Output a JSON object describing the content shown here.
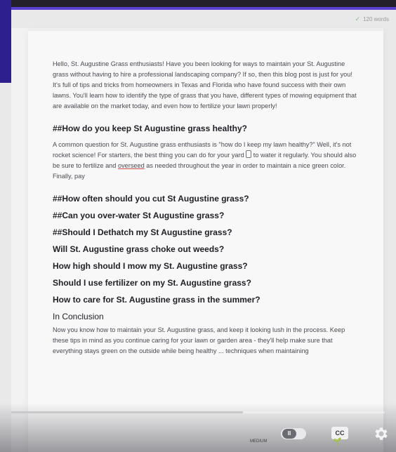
{
  "status": {
    "saved_text": "120 words"
  },
  "article": {
    "intro": "Hello, St. Augustine Grass enthusiasts! Have you been looking for ways to maintain your St. Augustine grass without having to hire a professional landscaping company? If so, then this blog post is just for you! It's full of tips and tricks from homeowners in Texas and Florida who have found success with their own lawns. You'll learn how to identify the type of grass that you have, different types of mowing equipment that are available on the market today, and even how to fertilize your lawn properly!",
    "h1": "##How do you keep St Augustine grass healthy?",
    "p1_a": "A common question for St. Augustine grass enthusiasts is \"how do I keep my lawn healthy?\" Well, it's not rocket science! For starters, the best thing you can do for your yard ",
    "p1_b": " to water it regularly. You should also be sure to fertilize and ",
    "p1_overseed": "overseed",
    "p1_c": " as needed throughout the year in order to maintain a nice green color. Finally, pay",
    "h2": "##How often should you cut St Augustine grass?",
    "h3": "##Can you over-water St Augustine grass?",
    "h4": "##Should I Dethatch my St Augustine grass?",
    "h5": "Will St. Augustine grass choke out weeds?",
    "h6": "How high should I mow my St. Augustine grass?",
    "h7": "Should I use fertilizer on my St. Augustine grass?",
    "h8": "How to care for St. Augustine grass in the summer?",
    "h9": "In Conclusion",
    "conclusion": "Now you know how to maintain your St. Augustine grass, and keep it looking lush in the process. Keep these tips in mind as you continue caring for your lawn or garden area - they'll help make sure that everything stays green on the outside while being healthy ... techniques when maintaining"
  },
  "video_controls": {
    "progress_fraction": 0.62,
    "cc_label": "CC",
    "medium_label": "MEDIUM",
    "toggle_icon": "II",
    "techniq": "techniq"
  }
}
